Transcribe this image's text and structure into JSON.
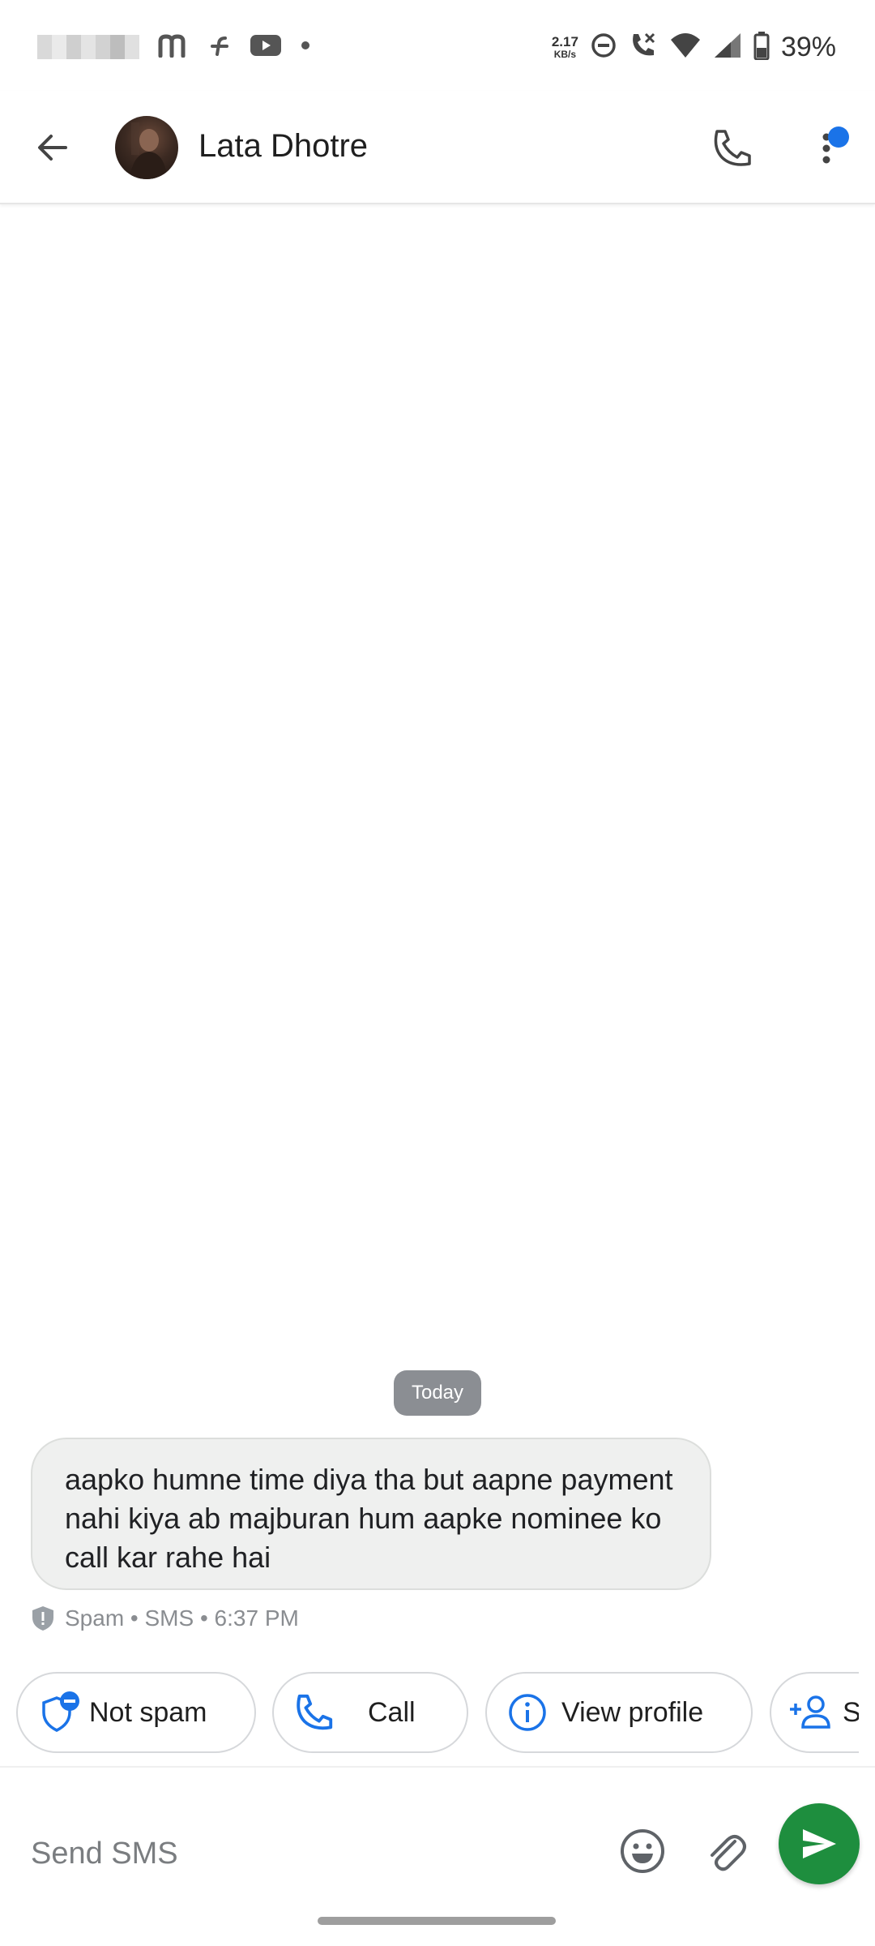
{
  "status_bar": {
    "network_speed_value": "2.17",
    "network_speed_unit": "KB/s",
    "battery_percent": "39%",
    "left_icons": [
      "blurred-app-icons",
      "m-icon",
      "f-icon",
      "youtube-icon",
      "dot-icon"
    ],
    "right_icons": [
      "do-not-disturb-icon",
      "wifi-calling-icon",
      "wifi-icon",
      "signal-icon",
      "battery-icon"
    ]
  },
  "app_bar": {
    "contact_name": "Lata Dhotre",
    "back_icon": "arrow-back-icon",
    "call_icon": "phone-icon",
    "more_icon": "more-vert-icon",
    "notification_dot_color": "#1a73e8"
  },
  "conversation": {
    "date_label": "Today",
    "messages": [
      {
        "text": "aapko humne time diya tha but aapne payment nahi kiya ab majburan hum aapke nominee ko call kar rahe hai",
        "meta": "Spam • SMS • 6:37 PM",
        "meta_icon": "spam-shield-icon"
      }
    ]
  },
  "suggestions": [
    {
      "label": "Not spam",
      "icon": "not-spam-shield-icon"
    },
    {
      "label": "Call",
      "icon": "phone-icon"
    },
    {
      "label": "View profile",
      "icon": "info-icon"
    },
    {
      "label": "S",
      "icon": "add-person-icon"
    }
  ],
  "composer": {
    "placeholder": "Send SMS",
    "value": "",
    "emoji_icon": "emoji-icon",
    "attach_icon": "attach-icon",
    "send_icon": "send-icon"
  },
  "colors": {
    "accent_blue": "#1a73e8",
    "send_green": "#1e8e3e",
    "bubble_bg": "#eff0ef"
  }
}
